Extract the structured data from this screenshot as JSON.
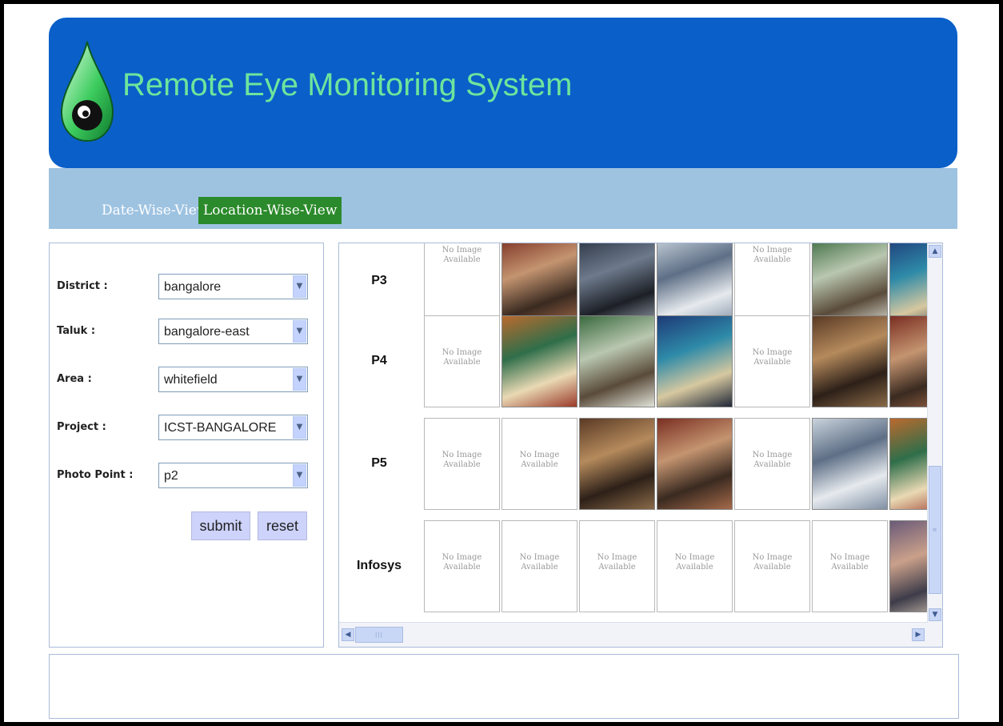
{
  "app": {
    "title": "Remote Eye Monitoring System"
  },
  "tabs": [
    {
      "label": "Date-Wise-View",
      "active": false
    },
    {
      "label": "Location-Wise-View",
      "active": true
    }
  ],
  "form": {
    "fields": [
      {
        "label": "District :",
        "value": "bangalore"
      },
      {
        "label": "Taluk :",
        "value": "bangalore-east"
      },
      {
        "label": "Area :",
        "value": "whitefield"
      },
      {
        "label": "Project :",
        "value": "ICST-BANGALORE"
      },
      {
        "label": "Photo Point :",
        "value": "p2"
      }
    ],
    "submit_label": "submit",
    "reset_label": "reset"
  },
  "gallery": {
    "no_image_line1": "No Image",
    "no_image_line2": "Available",
    "rows": [
      {
        "label": "P3",
        "cells": [
          "none",
          "photo",
          "photo",
          "photo",
          "none",
          "photo",
          "photo"
        ]
      },
      {
        "label": "P4",
        "cells": [
          "none",
          "photo",
          "photo",
          "photo",
          "none",
          "photo",
          "photo"
        ]
      },
      {
        "label": "P5",
        "cells": [
          "none",
          "none",
          "photo",
          "photo",
          "none",
          "photo",
          "photo"
        ]
      },
      {
        "label": "Infosys",
        "cells": [
          "none",
          "none",
          "none",
          "none",
          "none",
          "none",
          "photo"
        ]
      }
    ]
  },
  "colors": {
    "header": "#0a5fc9",
    "title": "#6de59c",
    "navbar": "#9ec3e1",
    "active_tab": "#2b8a2b"
  }
}
